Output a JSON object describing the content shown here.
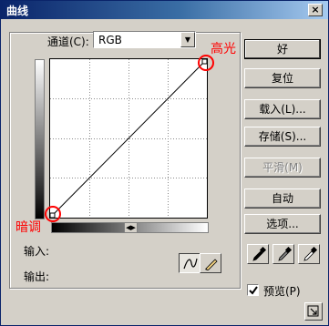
{
  "window": {
    "title": "曲线",
    "close_glyph": "×"
  },
  "channel": {
    "label": "通道(C):",
    "value": "RGB"
  },
  "buttons": {
    "ok": "好",
    "reset": "复位",
    "load": "载入(L)...",
    "save": "存储(S)...",
    "smooth": "平滑(M)",
    "auto": "自动",
    "options": "选项..."
  },
  "fields": {
    "input_label": "输入:",
    "output_label": "输出:"
  },
  "preview": {
    "label": "预览(P)",
    "checked": true
  },
  "annotations": {
    "highlight": "高光",
    "shadow": "暗调",
    "color": "#ff0000"
  },
  "curve": {
    "points": [
      [
        0,
        0
      ],
      [
        255,
        255
      ]
    ],
    "grid_divisions": 4
  },
  "icons": {
    "curve_tool": "curve-icon",
    "pencil_tool": "pencil-icon",
    "black_eyedropper": "eyedropper-black-icon",
    "gray_eyedropper": "eyedropper-gray-icon",
    "white_eyedropper": "eyedropper-white-icon",
    "expand": "expand-icon"
  }
}
